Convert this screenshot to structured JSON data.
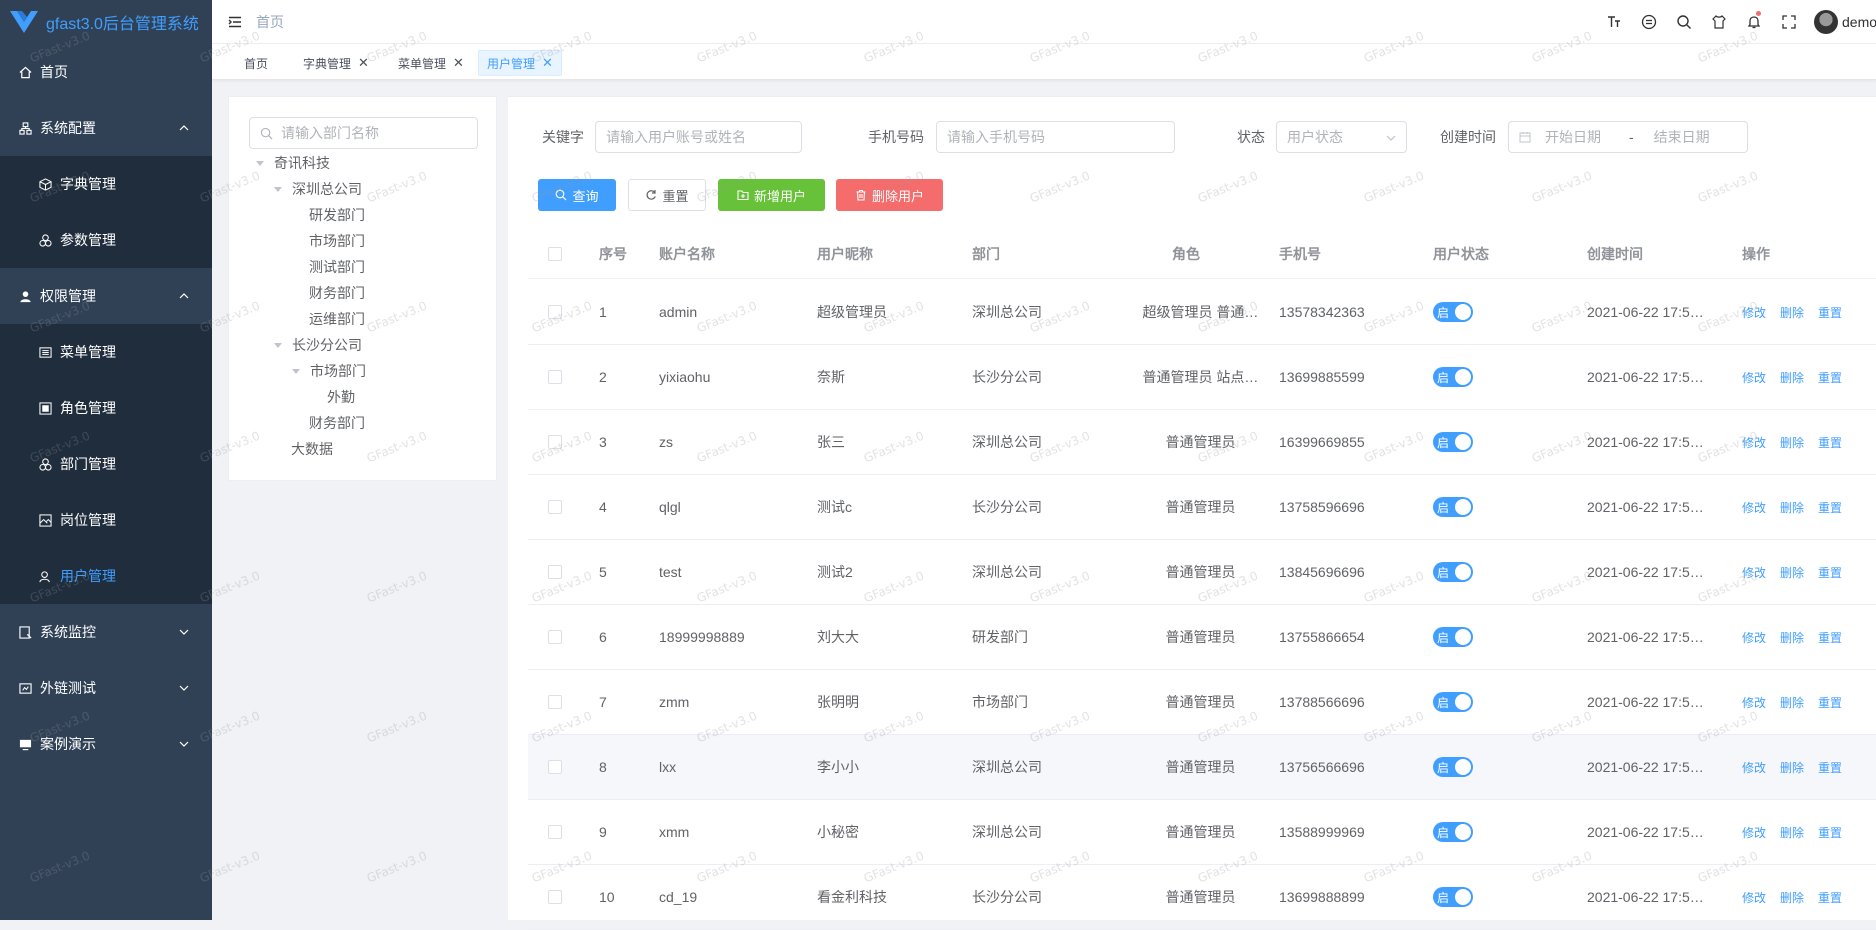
{
  "app": {
    "title": "gfast3.0后台管理系统",
    "watermark": "GFast-v3.0",
    "colors": {
      "sidebar": "#304156",
      "accent": "#409eff",
      "success": "#67c23a",
      "danger": "#f56c6c"
    }
  },
  "sidebar": {
    "items": [
      {
        "label": "首页",
        "icon": "home-icon",
        "level": 0
      },
      {
        "label": "系统配置",
        "icon": "system-icon",
        "level": 0,
        "expanded": true
      },
      {
        "label": "字典管理",
        "icon": "cube-icon",
        "level": 1
      },
      {
        "label": "参数管理",
        "icon": "params-icon",
        "level": 1
      },
      {
        "label": "权限管理",
        "icon": "user-icon",
        "level": 0,
        "expanded": true
      },
      {
        "label": "菜单管理",
        "icon": "menu-icon",
        "level": 1
      },
      {
        "label": "角色管理",
        "icon": "role-icon",
        "level": 1
      },
      {
        "label": "部门管理",
        "icon": "dept-icon",
        "level": 1
      },
      {
        "label": "岗位管理",
        "icon": "post-icon",
        "level": 1
      },
      {
        "label": "用户管理",
        "icon": "person-icon",
        "level": 1,
        "active": true
      },
      {
        "label": "系统监控",
        "icon": "monitor-icon",
        "level": 0,
        "expanded": false
      },
      {
        "label": "外链测试",
        "icon": "link-icon",
        "level": 0,
        "expanded": false
      },
      {
        "label": "案例演示",
        "icon": "demo-icon",
        "level": 0,
        "expanded": false
      }
    ]
  },
  "header": {
    "breadcrumb": "首页",
    "icons": [
      "font-size-icon",
      "layout-icon",
      "search-icon",
      "theme-icon",
      "bell-icon",
      "fullscreen-icon"
    ],
    "username": "demo"
  },
  "tags": [
    {
      "label": "首页",
      "closable": false
    },
    {
      "label": "字典管理",
      "closable": true
    },
    {
      "label": "菜单管理",
      "closable": true
    },
    {
      "label": "用户管理",
      "closable": true,
      "active": true
    }
  ],
  "tree": {
    "placeholder": "请输入部门名称",
    "nodes": [
      {
        "label": "奇讯科技",
        "caret": true
      },
      {
        "label": "深圳总公司",
        "caret": true
      },
      {
        "label": "研发部门",
        "caret": false
      },
      {
        "label": "市场部门",
        "caret": false
      },
      {
        "label": "测试部门",
        "caret": false
      },
      {
        "label": "财务部门",
        "caret": false
      },
      {
        "label": "运维部门",
        "caret": false
      },
      {
        "label": "长沙分公司",
        "caret": true
      },
      {
        "label": "市场部门",
        "caret": true
      },
      {
        "label": "外勤",
        "caret": false
      },
      {
        "label": "财务部门",
        "caret": false
      },
      {
        "label": "大数据",
        "caret": false
      }
    ]
  },
  "filters": {
    "keyword_label": "关键字",
    "keyword_placeholder": "请输入用户账号或姓名",
    "phone_label": "手机号码",
    "phone_placeholder": "请输入手机号码",
    "status_label": "状态",
    "status_placeholder": "用户状态",
    "time_label": "创建时间",
    "start_placeholder": "开始日期",
    "range_sep": "-",
    "end_placeholder": "结束日期"
  },
  "buttons": {
    "query": "查询",
    "reset": "重置",
    "add": "新增用户",
    "delete": "删除用户"
  },
  "table": {
    "headers": [
      "序号",
      "账户名称",
      "用户昵称",
      "部门",
      "角色",
      "手机号",
      "用户状态",
      "创建时间",
      "操作"
    ],
    "switch_on_text": "启",
    "actions": [
      "修改",
      "删除",
      "重置"
    ],
    "rows": [
      {
        "no": "1",
        "account": "admin",
        "nickname": "超级管理员",
        "dept": "深圳总公司",
        "role": "超级管理员 普通…",
        "phone": "13578342363",
        "created": "2021-06-22 17:5…"
      },
      {
        "no": "2",
        "account": "yixiaohu",
        "nickname": "奈斯",
        "dept": "长沙分公司",
        "role": "普通管理员 站点…",
        "phone": "13699885599",
        "created": "2021-06-22 17:5…"
      },
      {
        "no": "3",
        "account": "zs",
        "nickname": "张三",
        "dept": "深圳总公司",
        "role": "普通管理员",
        "phone": "16399669855",
        "created": "2021-06-22 17:5…"
      },
      {
        "no": "4",
        "account": "qlgl",
        "nickname": "测试c",
        "dept": "长沙分公司",
        "role": "普通管理员",
        "phone": "13758596696",
        "created": "2021-06-22 17:5…"
      },
      {
        "no": "5",
        "account": "test",
        "nickname": "测试2",
        "dept": "深圳总公司",
        "role": "普通管理员",
        "phone": "13845696696",
        "created": "2021-06-22 17:5…"
      },
      {
        "no": "6",
        "account": "18999998889",
        "nickname": "刘大大",
        "dept": "研发部门",
        "role": "普通管理员",
        "phone": "13755866654",
        "created": "2021-06-22 17:5…"
      },
      {
        "no": "7",
        "account": "zmm",
        "nickname": "张明明",
        "dept": "市场部门",
        "role": "普通管理员",
        "phone": "13788566696",
        "created": "2021-06-22 17:5…"
      },
      {
        "no": "8",
        "account": "lxx",
        "nickname": "李小小",
        "dept": "深圳总公司",
        "role": "普通管理员",
        "phone": "13756566696",
        "created": "2021-06-22 17:5…"
      },
      {
        "no": "9",
        "account": "xmm",
        "nickname": "小秘密",
        "dept": "深圳总公司",
        "role": "普通管理员",
        "phone": "13588999969",
        "created": "2021-06-22 17:5…"
      },
      {
        "no": "10",
        "account": "cd_19",
        "nickname": "看金利科技",
        "dept": "长沙分公司",
        "role": "普通管理员",
        "phone": "13699888899",
        "created": "2021-06-22 17:5…"
      }
    ]
  }
}
